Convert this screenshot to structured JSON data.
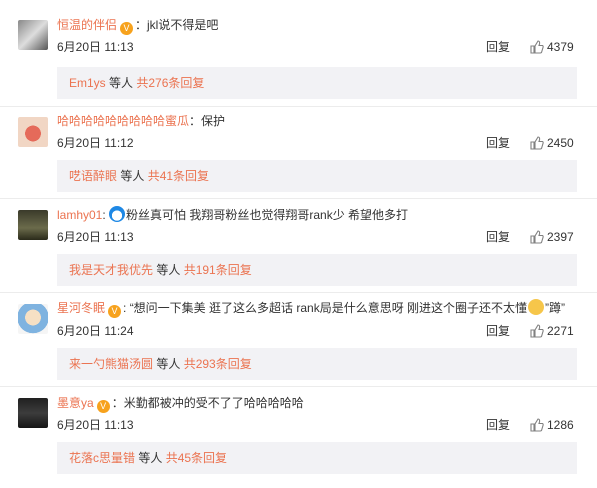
{
  "comments": [
    {
      "username": "恒温的伴侣",
      "text": "：jkl说不得是吧",
      "time": "6月20日 11:13",
      "reply_label": "回复",
      "likes": "4379",
      "sub_user": "Em1ys",
      "sub_mid": " 等人 ",
      "sub_count": "共276条回复",
      "avatar_icon": "avatar-icon"
    },
    {
      "username": "哈哈哈哈哈哈哈哈哈蜜瓜",
      "text": "：保护",
      "time": "6月20日 11:12",
      "reply_label": "回复",
      "likes": "2450",
      "sub_user": "呓语醉眼",
      "sub_mid": " 等人 ",
      "sub_count": "共41条回复",
      "avatar_icon": "avatar-icon"
    },
    {
      "username": "lamhy01",
      "text": "粉丝真可怕 我翔哥粉丝也觉得翔哥rank少 希望他多打",
      "time": "6月20日 11:13",
      "reply_label": "回复",
      "likes": "2397",
      "sub_user": "我是天才我优先",
      "sub_mid": " 等人 ",
      "sub_count": "共191条回复",
      "avatar_icon": "avatar-icon"
    },
    {
      "username": "星河冬眠",
      "text": "“想问一下集美 逛了这么多超话 rank局是什么意思呀 刚进这个圈子还不太懂",
      "text_end": "”蹲”",
      "time": "6月20日 11:24",
      "reply_label": "回复",
      "likes": "2271",
      "sub_user": "来一勺熊猫汤圆",
      "sub_mid": " 等人 ",
      "sub_count": "共293条回复",
      "avatar_icon": "avatar-icon"
    },
    {
      "username": "墨意ya",
      "text": "：米勤都被冲的受不了了哈哈哈哈哈",
      "time": "6月20日 11:13",
      "reply_label": "回复",
      "likes": "1286",
      "sub_user": "花落c思量错",
      "sub_mid": " 等人 ",
      "sub_count": "共45条回复",
      "avatar_icon": "avatar-icon"
    }
  ],
  "colors": {
    "link": "#eb7350",
    "sub_bg": "#f2f2f5",
    "badge": "#f7a21d"
  }
}
